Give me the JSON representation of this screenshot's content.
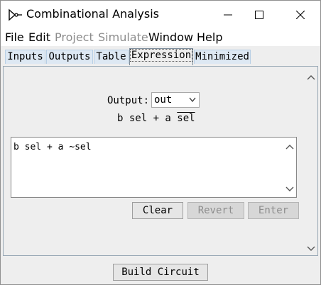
{
  "window": {
    "title": "Combinational Analysis"
  },
  "menu": {
    "file": "File",
    "edit": "Edit",
    "project": "Project",
    "simulate": "Simulate",
    "window": "Window",
    "help": "Help"
  },
  "tabs": [
    {
      "label": "Inputs"
    },
    {
      "label": "Outputs"
    },
    {
      "label": "Table"
    },
    {
      "label": "Expression",
      "selected": true
    },
    {
      "label": "Minimized"
    }
  ],
  "expression_panel": {
    "output_label": "Output:",
    "output_selected": "out",
    "display": {
      "term1": "b sel + a ",
      "negated_var": "sel"
    },
    "editor_text": "b sel + a ~sel",
    "buttons": {
      "clear": "Clear",
      "revert": "Revert",
      "enter": "Enter"
    }
  },
  "footer": {
    "build_circuit": "Build Circuit"
  },
  "colors": {
    "tab_bg": "#dde8f3",
    "tab_border": "#b8cfe5",
    "panel_bg": "#eeeeee"
  }
}
